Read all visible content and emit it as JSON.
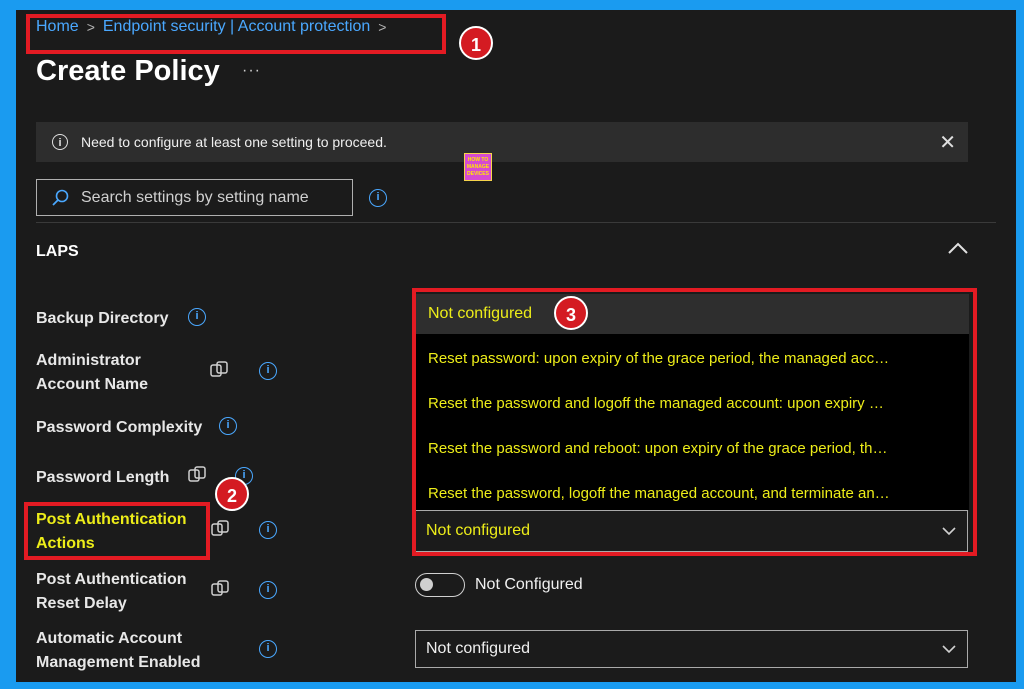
{
  "breadcrumb": {
    "home": "Home",
    "separator": ">",
    "current": "Endpoint security | Account protection"
  },
  "page": {
    "title": "Create Policy",
    "more": "···"
  },
  "banner": {
    "message": "Need to configure at least one setting to proceed.",
    "info_icon": "i",
    "close_icon": "✕"
  },
  "logo": {
    "text": "HOW TO MANAGE DEVICES"
  },
  "search": {
    "placeholder": "Search settings by setting name",
    "value": ""
  },
  "section": {
    "title": "LAPS"
  },
  "settings": [
    {
      "label": "Backup Directory"
    },
    {
      "label": "Administrator Account Name"
    },
    {
      "label": "Password Complexity"
    },
    {
      "label": "Password Length"
    },
    {
      "label": "Post Authentication Actions"
    },
    {
      "label": "Post Authentication Reset Delay"
    },
    {
      "label": "Automatic Account Management Enabled"
    }
  ],
  "post_auth_dropdown": {
    "value": "Not configured",
    "options": [
      "Not configured",
      "Reset password: upon expiry of the grace period, the managed acc…",
      "Reset the password and logoff the managed account: upon expiry …",
      "Reset the password and reboot: upon expiry of the grace period, th…",
      "Reset the password, logoff the managed account, and terminate an…"
    ]
  },
  "reset_delay_toggle": {
    "label": "Not Configured",
    "state": "off"
  },
  "auto_account_dropdown": {
    "value": "Not configured"
  },
  "badges": [
    "1",
    "2",
    "3"
  ],
  "colors": {
    "accent": "#4aa8ff",
    "highlight": "#eded19",
    "callout": "#e31b23",
    "frame": "#1a9bf0"
  }
}
